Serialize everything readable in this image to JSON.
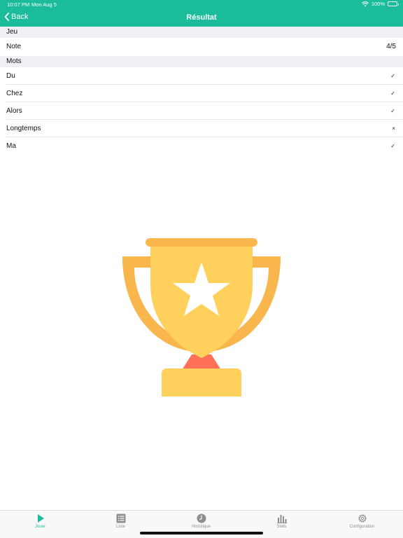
{
  "status": {
    "time": "10:07 PM",
    "date": "Mon Aug 5",
    "battery": "100%"
  },
  "nav": {
    "back_label": "Back",
    "title": "Résultat"
  },
  "sections": {
    "jeu": "Jeu",
    "mots": "Mots"
  },
  "note": {
    "label": "Note",
    "value": "4/5"
  },
  "words": [
    {
      "word": "Du",
      "mark": "✓"
    },
    {
      "word": "Chez",
      "mark": "✓"
    },
    {
      "word": "Alors",
      "mark": "✓"
    },
    {
      "word": "Longtemps",
      "mark": "×"
    },
    {
      "word": "Ma",
      "mark": "✓"
    }
  ],
  "tabs": [
    {
      "label": "Jouer",
      "icon": "play-icon"
    },
    {
      "label": "Liste",
      "icon": "list-icon"
    },
    {
      "label": "Historique",
      "icon": "clock-icon"
    },
    {
      "label": "Stats",
      "icon": "bar-chart-icon"
    },
    {
      "label": "Configuration",
      "icon": "gear-icon"
    }
  ],
  "colors": {
    "accent": "#1bbc9b",
    "trophy_body": "#ffd15c",
    "trophy_handles": "#f8b64c",
    "trophy_neck": "#ff7058",
    "star": "#ffffff"
  }
}
